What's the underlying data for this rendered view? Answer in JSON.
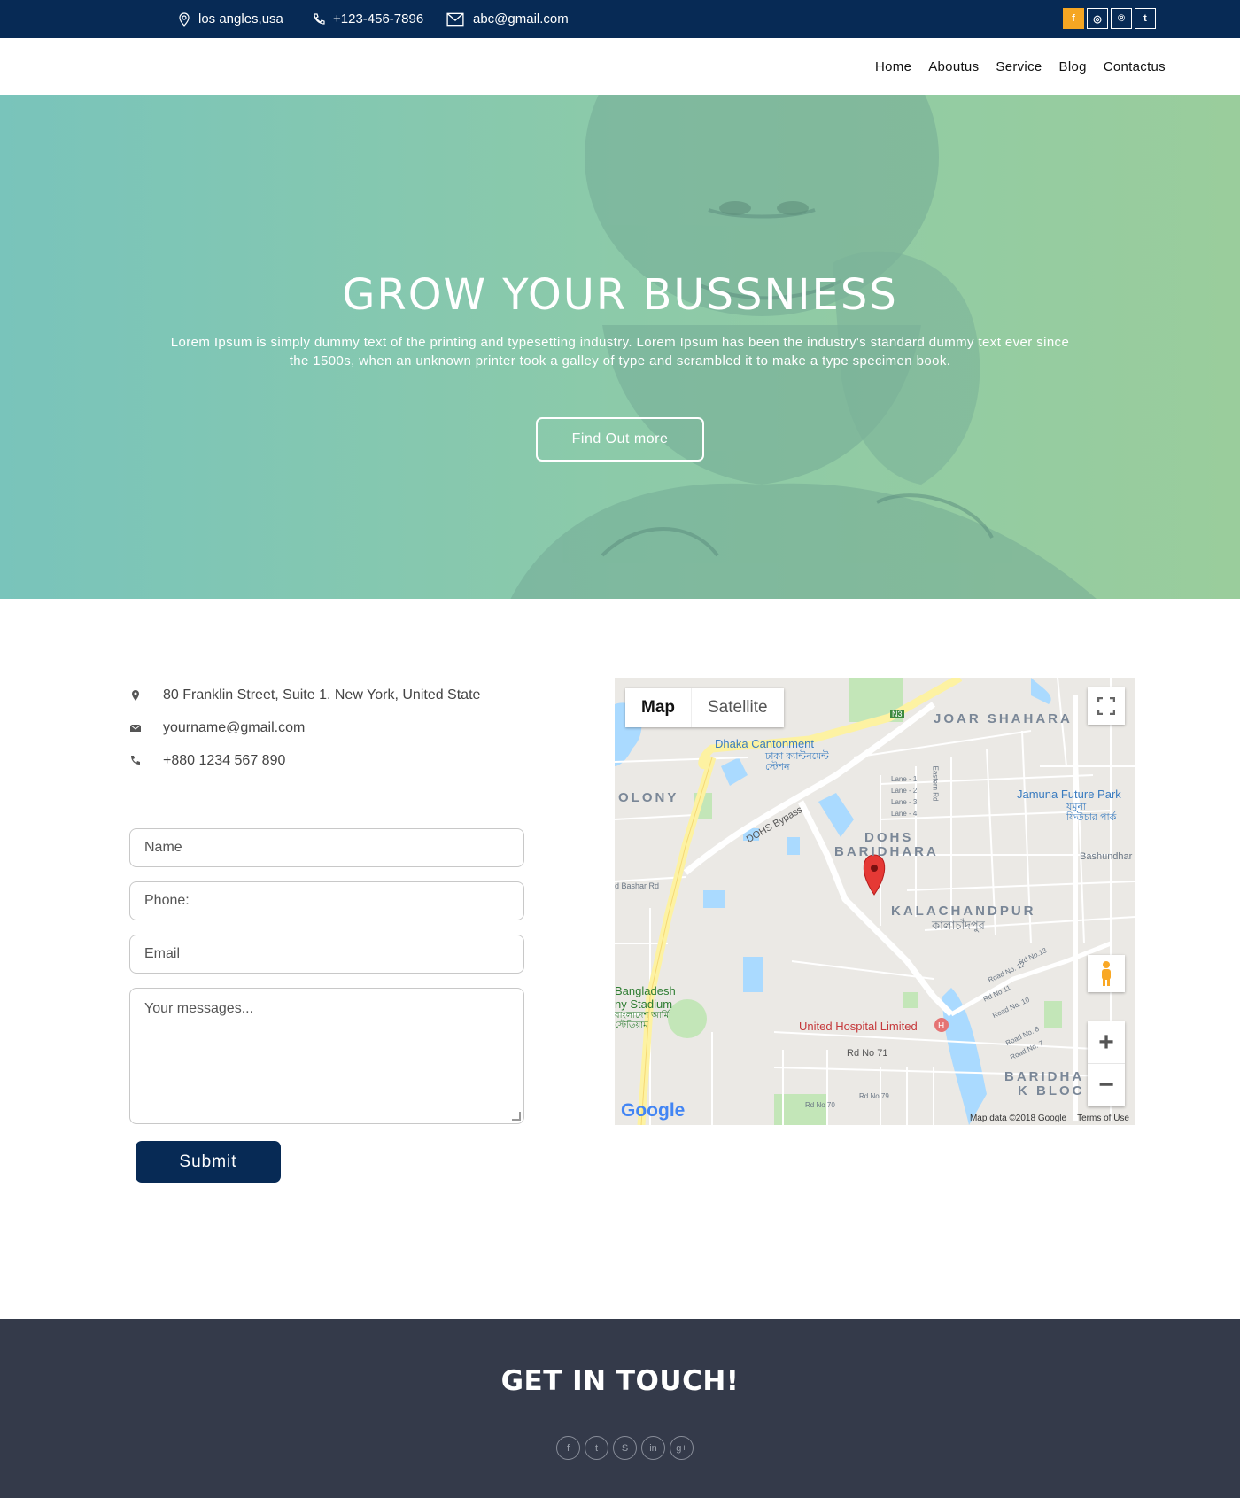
{
  "topbar": {
    "location": "los angles,usa",
    "phone": "+123-456-7896",
    "email": "abc@gmail.com",
    "socials": [
      {
        "icon": "facebook-icon",
        "glyph": "f"
      },
      {
        "icon": "instagram-icon",
        "glyph": "◎"
      },
      {
        "icon": "pinterest-icon",
        "glyph": "℗"
      },
      {
        "icon": "twitter-icon",
        "glyph": "t"
      }
    ]
  },
  "nav": {
    "items": [
      "Home",
      "Aboutus",
      "Service",
      "Blog",
      "Contactus"
    ]
  },
  "hero": {
    "title": "GROW YOUR BUSSNIESS",
    "text": "Lorem Ipsum is simply dummy text of the printing and typesetting industry. Lorem Ipsum has been the industry's standard dummy text ever since the 1500s, when an unknown printer took a galley of type and scrambled it to make a type specimen book.",
    "cta_label": "Find Out more"
  },
  "contact_info": {
    "address": "80 Franklin Street, Suite 1. New York, United State",
    "email": "yourname@gmail.com",
    "phone": "+880 1234 567 890"
  },
  "form": {
    "name_placeholder": "Name",
    "phone_placeholder": "Phone:",
    "email_placeholder": "Email",
    "message_placeholder": "Your messages...",
    "submit_label": "Submit"
  },
  "map": {
    "tab_map": "Map",
    "tab_satellite": "Satellite",
    "labels": {
      "joar_shahara": "JOAR SHAHARA",
      "dhaka_cantonment": "Dhaka Cantonment",
      "dhaka_cantonment_bn": "ঢাকা ক্যান্টনমেন্ট স্টেশন",
      "colony": "OLONY",
      "dohs_bypass": "DOHS Bypass",
      "dohs_baridhara_1": "DOHS",
      "dohs_baridhara_2": "BARIDHARA",
      "jamuna_future_park": "Jamuna Future Park",
      "jamuna_bn": "যমুনা ফিউচার পার্ক",
      "bashundhara": "Bashundhar",
      "kalachandpur": "KALACHANDPUR",
      "kalachandpur_bn": "কালাচাঁদপুর",
      "bashar_rd": "d Bashar Rd",
      "stadium_1": "Bangladesh",
      "stadium_2": "ny Stadium",
      "stadium_bn": "বাংলাদেশ আর্মি স্টেডিয়াম",
      "united_hospital": "United Hospital Limited",
      "rd71": "Rd No 71",
      "baridhara_k_1": "BARIDHA",
      "baridhara_k_2": "K BLOC",
      "lane1": "Lane - 1",
      "lane2": "Lane - 2",
      "lane3": "Lane - 3",
      "lane4": "Lane - 4",
      "eastern_rd": "Eastern Rd",
      "rd13": "Rd No.13",
      "rd12": "Road No. 12",
      "rd11": "Rd No 11",
      "rd10": "Road No. 10",
      "rd8": "Road No. 8",
      "rd7": "Road No. 7",
      "rd70": "Rd No 70",
      "rd79": "Rd No 79",
      "n3": "N3"
    },
    "google": "Google",
    "attribution": "Map data ©2018 Google",
    "terms": "Terms of Use"
  },
  "footer": {
    "title": "GET IN TOUCH!",
    "socials": [
      {
        "icon": "facebook-icon",
        "glyph": "f"
      },
      {
        "icon": "twitter-icon",
        "glyph": "t"
      },
      {
        "icon": "skype-icon",
        "glyph": "S"
      },
      {
        "icon": "linkedin-icon",
        "glyph": "in"
      },
      {
        "icon": "google-plus-icon",
        "glyph": "g+"
      }
    ]
  },
  "colors": {
    "navy": "#072a55",
    "accent": "#f5a623",
    "hero_teal": "#79c4bb",
    "footer_bg": "#343a4a"
  }
}
